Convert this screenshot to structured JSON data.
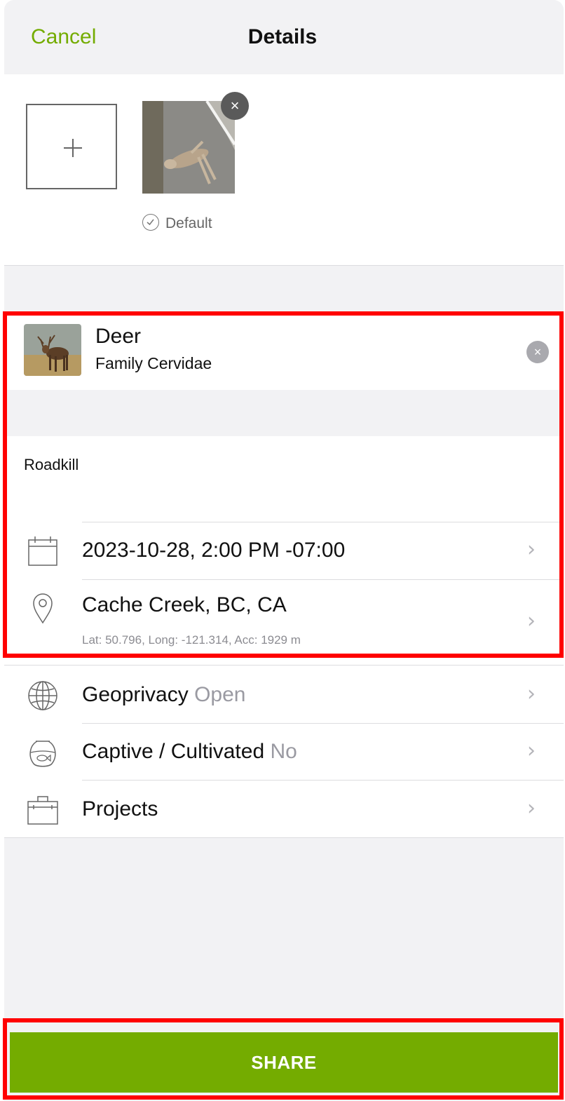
{
  "nav": {
    "cancel_label": "Cancel",
    "title": "Details"
  },
  "photos": {
    "default_label": "Default",
    "remove_symbol": "×"
  },
  "species": {
    "common_name": "Deer",
    "taxon": "Family Cervidae",
    "remove_symbol": "×"
  },
  "notes": "Roadkill",
  "date_row": {
    "label": "2023-10-28, 2:00 PM -07:00"
  },
  "location_row": {
    "label": "Cache Creek, BC, CA",
    "coords": "Lat: 50.796, Long: -121.314, Acc: 1929 m"
  },
  "geoprivacy_row": {
    "label": "Geoprivacy",
    "value": "Open"
  },
  "captive_row": {
    "label": "Captive / Cultivated",
    "value": "No"
  },
  "projects_row": {
    "label": "Projects"
  },
  "chevron": "›",
  "share_label": "SHARE",
  "colors": {
    "accent": "#74ac00",
    "highlight": "#ff0000",
    "background_gray": "#f2f2f4"
  },
  "icons": [
    "plus-icon",
    "close-icon",
    "check-circle-icon",
    "calendar-icon",
    "map-pin-icon",
    "globe-icon",
    "fishbowl-icon",
    "briefcase-icon",
    "chevron-right-icon"
  ]
}
